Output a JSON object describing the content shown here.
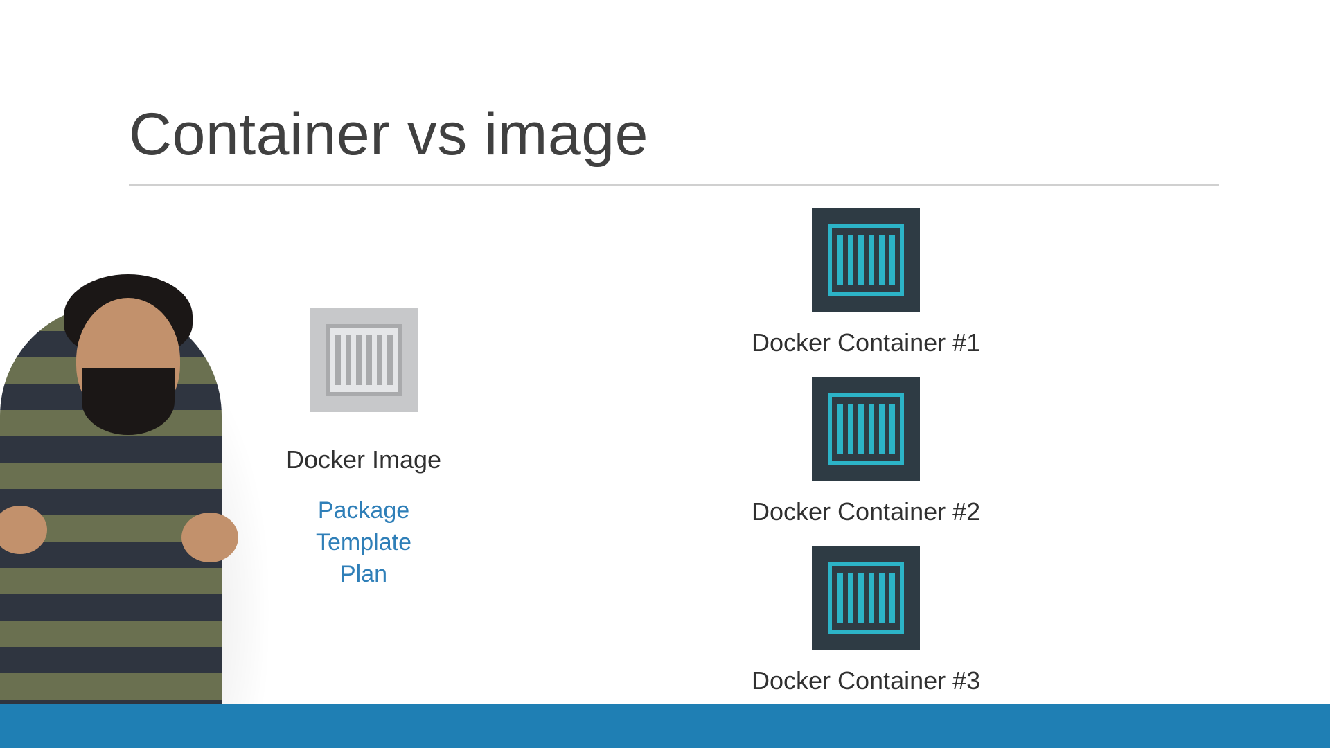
{
  "title": "Container vs image",
  "image_block": {
    "label": "Docker Image",
    "keywords": [
      "Package",
      "Template",
      "Plan"
    ]
  },
  "containers": [
    {
      "label": "Docker Container #1"
    },
    {
      "label": "Docker Container #2"
    },
    {
      "label": "Docker Container #3"
    }
  ]
}
